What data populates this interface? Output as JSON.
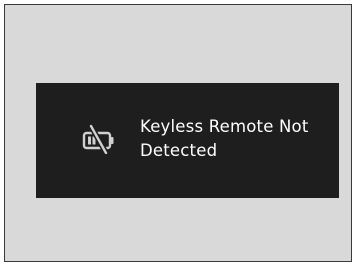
{
  "message": {
    "line1": "Keyless Remote Not",
    "line2": "Detected"
  },
  "icons": {
    "status_icon": "keyless-remote-battery-slash-icon"
  },
  "colors": {
    "page_background": "#d9d9d9",
    "display_background": "#1e1e1e",
    "text": "#ffffff"
  }
}
